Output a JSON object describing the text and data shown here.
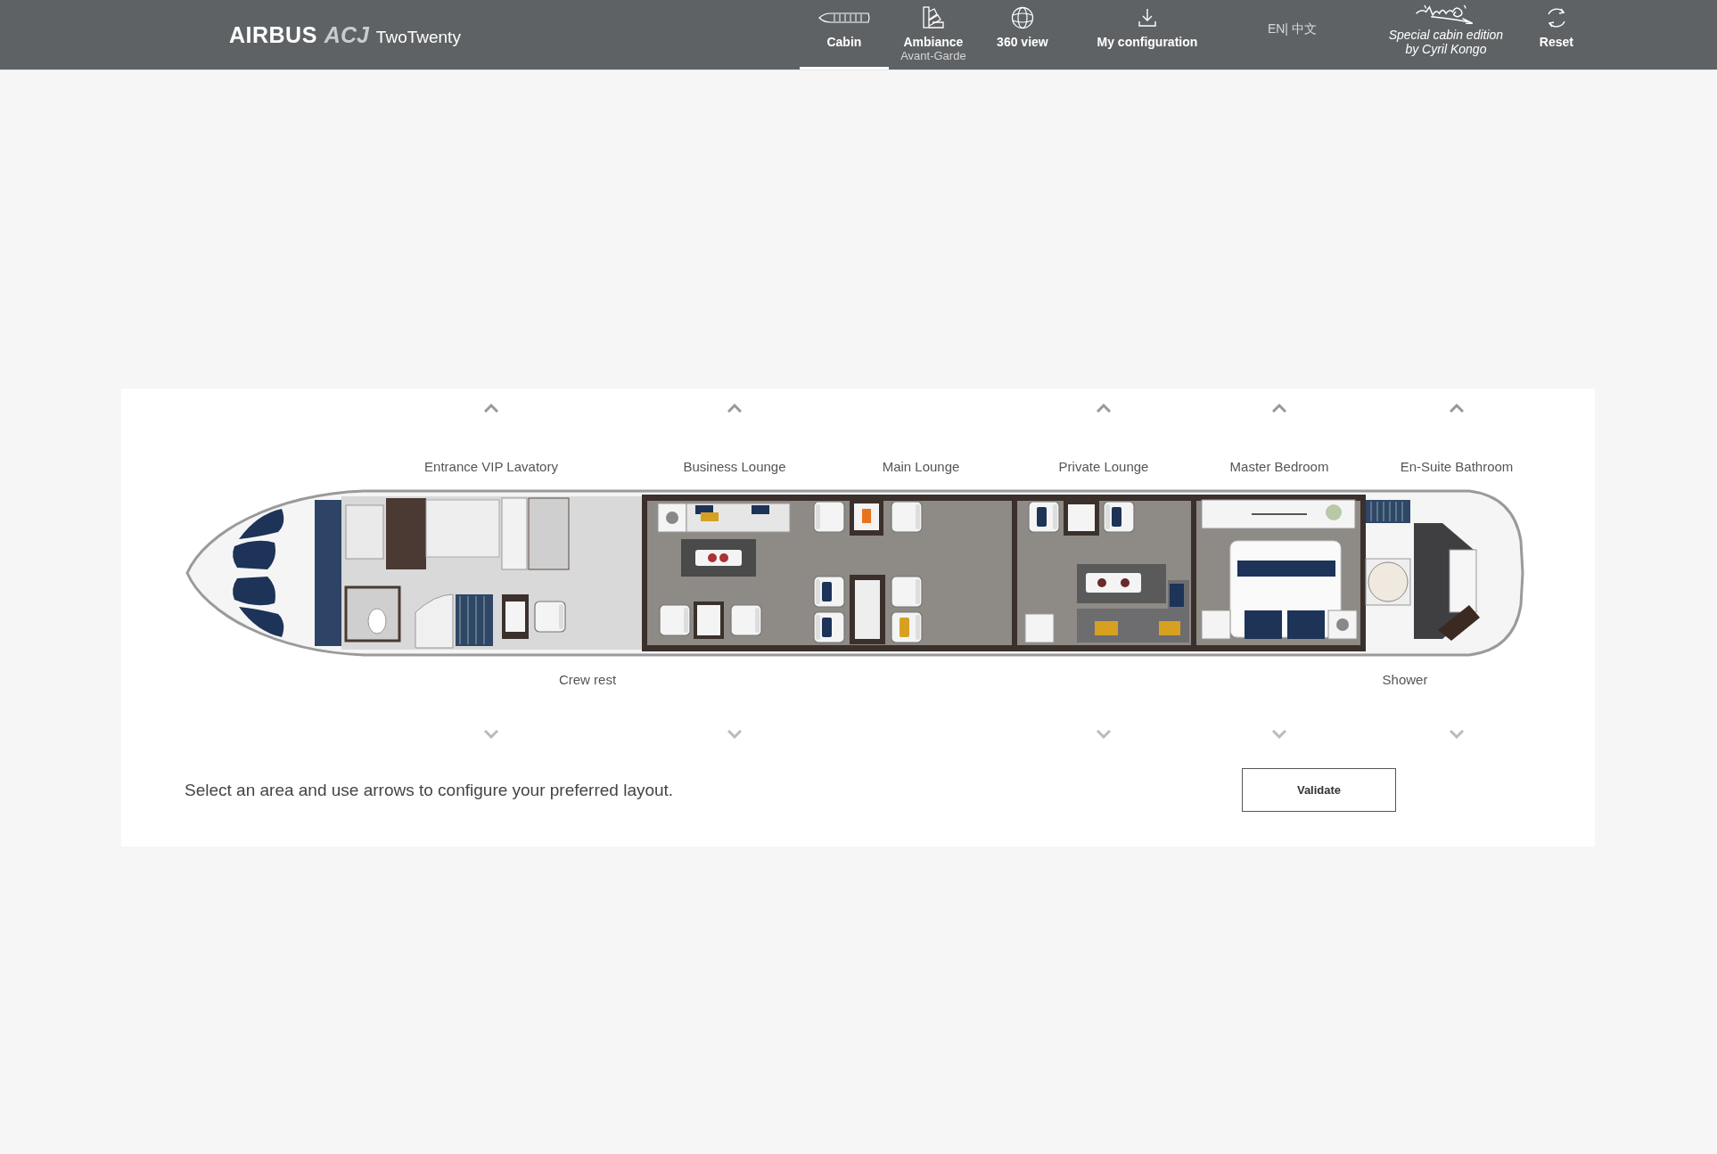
{
  "header": {
    "logo": {
      "brand": "AIRBUS",
      "model": "ACJ",
      "name": "TwoTwenty"
    },
    "nav": [
      {
        "kind": "cabin",
        "label": "Cabin",
        "selected": true
      },
      {
        "kind": "ambiance",
        "label": "Ambiance",
        "sublabel": "Avant-Garde",
        "selected": false
      },
      {
        "kind": "view",
        "label": "360 view",
        "selected": false
      },
      {
        "kind": "download",
        "label": "My configuration",
        "selected": false
      },
      {
        "kind": "language",
        "label": "EN| 中文",
        "selected": false
      },
      {
        "kind": "edition",
        "label": "Special cabin edition",
        "sublabel": "by Cyril Kongo",
        "selected": false
      },
      {
        "kind": "reset",
        "label": "Reset",
        "selected": false
      }
    ]
  },
  "cabin_plan": {
    "zones_top": [
      {
        "label": "Entrance VIP Lavatory",
        "arrows": true
      },
      {
        "label": "Business Lounge",
        "arrows": true
      },
      {
        "label": "Main Lounge",
        "arrows": false
      },
      {
        "label": "Private Lounge",
        "arrows": true
      },
      {
        "label": "Master Bedroom",
        "arrows": true
      },
      {
        "label": "En-Suite Bathroom",
        "arrows": true
      }
    ],
    "zones_bottom": [
      {
        "label": "Crew rest"
      },
      {
        "label": "Shower"
      }
    ]
  },
  "instruction": "Select an area and use arrows to configure your preferred layout.",
  "validate_button": "Validate"
}
